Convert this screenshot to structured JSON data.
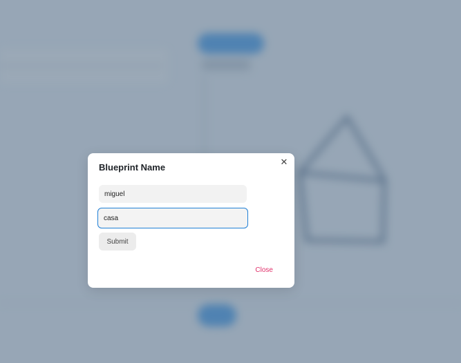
{
  "background": {
    "accent_color": "#2f8fe6"
  },
  "modal": {
    "title": "Blueprint Name",
    "close_icon": "close-icon",
    "name_field": {
      "value": "miguel",
      "placeholder": ""
    },
    "place_field": {
      "value": "casa",
      "placeholder": ""
    },
    "submit_label": "Submit",
    "close_label": "Close",
    "close_color": "#e0306a",
    "focus_color": "#1f7fd6"
  }
}
